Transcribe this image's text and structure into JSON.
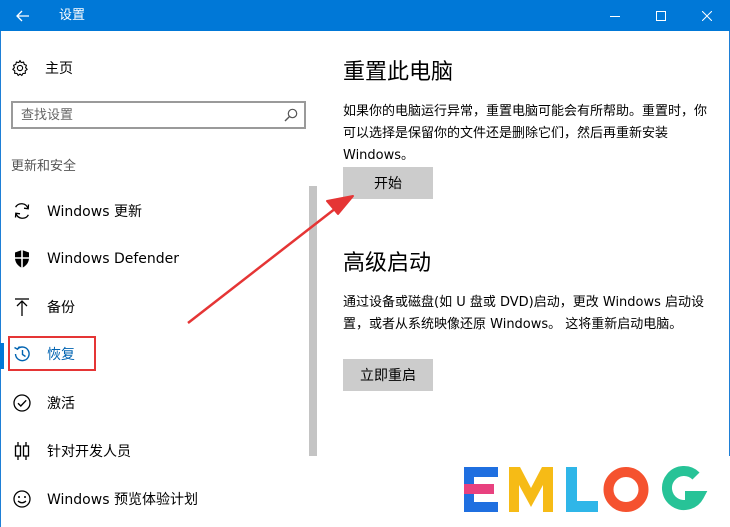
{
  "window": {
    "title": "设置",
    "accent": "#0078d7"
  },
  "sidebar": {
    "home_label": "主页",
    "search_placeholder": "查找设置",
    "section_title": "更新和安全",
    "items": [
      {
        "label": "Windows 更新",
        "icon": "sync-icon"
      },
      {
        "label": "Windows Defender",
        "icon": "shield-icon"
      },
      {
        "label": "备份",
        "icon": "upload-arrow-icon"
      },
      {
        "label": "恢复",
        "icon": "history-icon",
        "active": true
      },
      {
        "label": "激活",
        "icon": "check-circle-icon"
      },
      {
        "label": "针对开发人员",
        "icon": "developer-icon"
      },
      {
        "label": "Windows 预览体验计划",
        "icon": "smiley-icon"
      }
    ]
  },
  "main": {
    "reset": {
      "title": "重置此电脑",
      "description": "如果你的电脑运行异常，重置电脑可能会有所帮助。重置时，你可以选择是保留你的文件还是删除它们，然后再重新安装 Windows。",
      "button": "开始"
    },
    "advanced": {
      "title": "高级启动",
      "description": "通过设备或磁盘(如 U 盘或 DVD)启动，更改 Windows 启动设置，或者从系统映像还原 Windows。 这将重新启动电脑。",
      "button": "立即重启"
    }
  },
  "annotation": {
    "highlight_color": "#e53535",
    "arrow_color": "#e53535"
  },
  "watermark": {
    "text": "EMLOG",
    "colors": [
      "#1f6fe0",
      "#e8417f",
      "#f6bb16",
      "#2fb6e8",
      "#f5522f",
      "#27c397"
    ]
  }
}
